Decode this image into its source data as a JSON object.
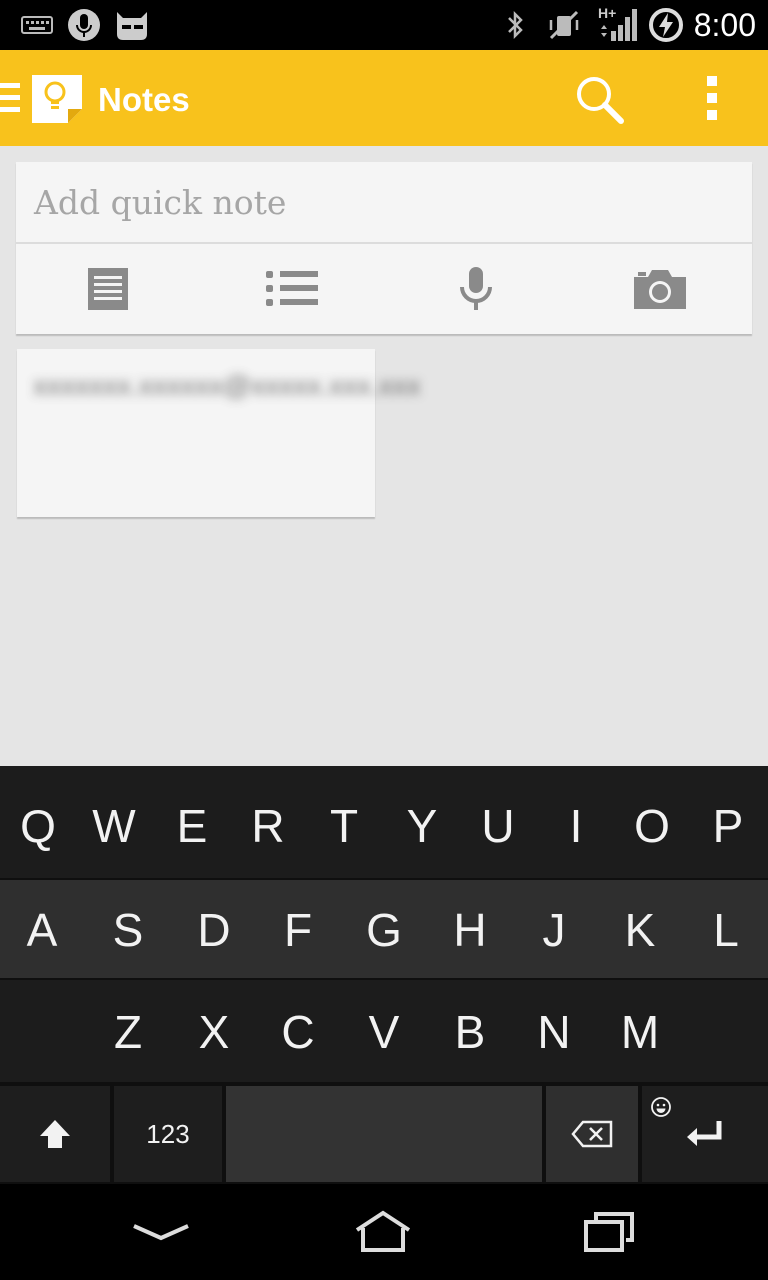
{
  "status_bar": {
    "time": "8:00",
    "icons": [
      "keyboard-icon",
      "mic-icon",
      "cyanogen-icon",
      "bluetooth-icon",
      "vibrate-off-icon",
      "signal-icon",
      "battery-charging-icon"
    ],
    "network_type": "H+"
  },
  "app_bar": {
    "title": "Notes",
    "accent_color": "#f8c21c"
  },
  "quick_note": {
    "placeholder": "Add quick note",
    "actions": [
      "text-note",
      "list-note",
      "voice-note",
      "photo-note"
    ]
  },
  "notes": [
    {
      "text": "xxxxxxx.xxxxxx@xxxxx.xxx.xxx"
    }
  ],
  "keyboard": {
    "row1": [
      "Q",
      "W",
      "E",
      "R",
      "T",
      "Y",
      "U",
      "I",
      "O",
      "P"
    ],
    "row2": [
      "A",
      "S",
      "D",
      "F",
      "G",
      "H",
      "J",
      "K",
      "L"
    ],
    "row3": [
      "Z",
      "X",
      "C",
      "V",
      "B",
      "N",
      "M"
    ],
    "numbers_label": "123"
  },
  "nav_bar": {
    "buttons": [
      "back",
      "home",
      "recents"
    ]
  }
}
